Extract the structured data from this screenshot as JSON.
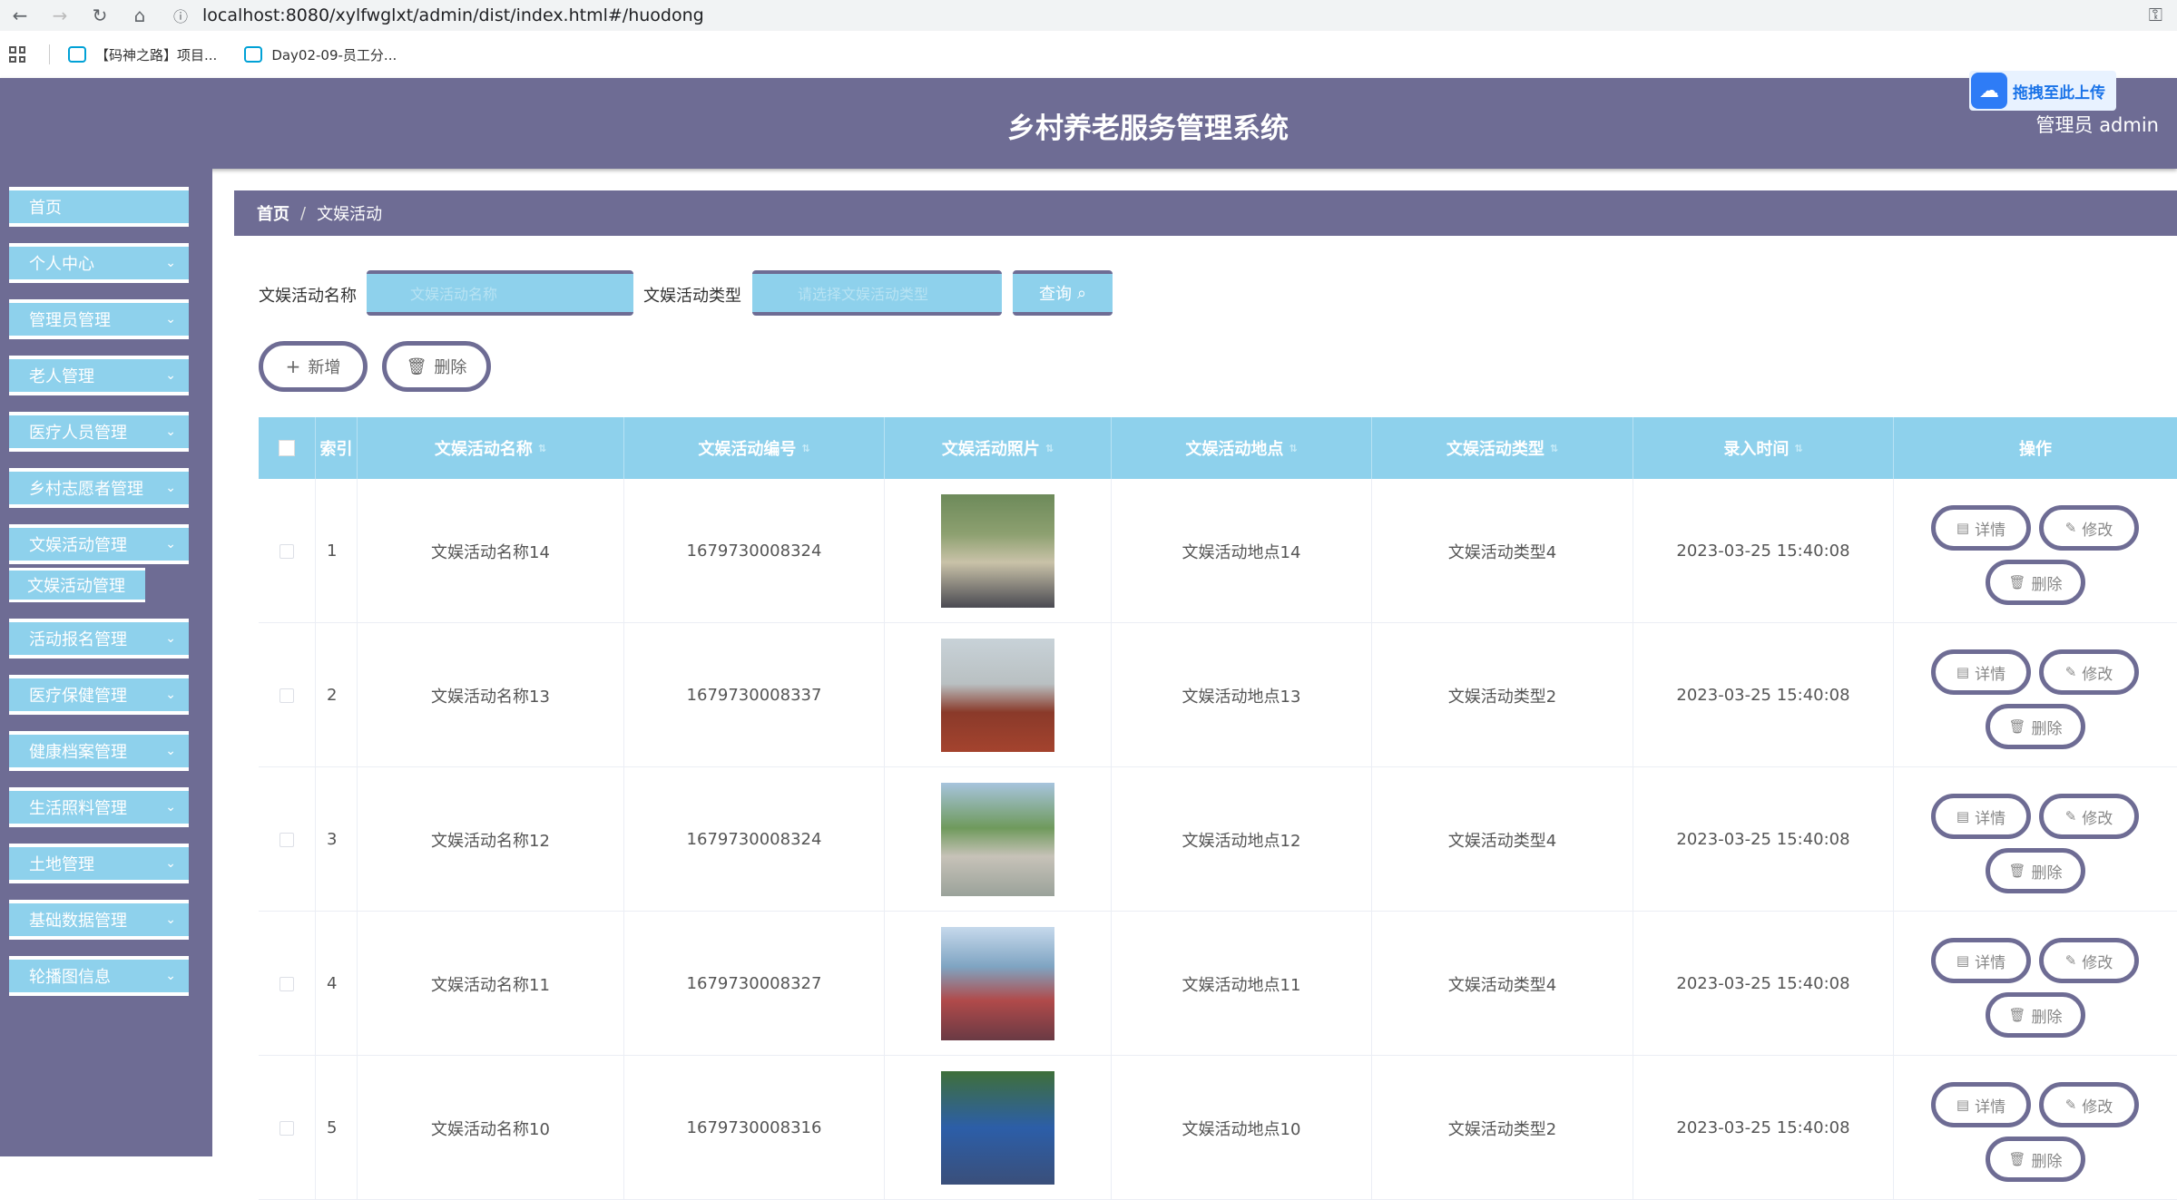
{
  "browser": {
    "url": "localhost:8080/xylfwglxt/admin/dist/index.html#/huodong",
    "bookmarks": [
      "【码神之路】项目...",
      "Day02-09-员工分..."
    ]
  },
  "header": {
    "title": "乡村养老服务管理系统",
    "upload_label": "拖拽至此上传",
    "user_label": "管理员 admin"
  },
  "sidebar": {
    "items": [
      {
        "label": "首页",
        "has_chevron": false
      },
      {
        "label": "个人中心",
        "has_chevron": true
      },
      {
        "label": "管理员管理",
        "has_chevron": true
      },
      {
        "label": "老人管理",
        "has_chevron": true
      },
      {
        "label": "医疗人员管理",
        "has_chevron": true
      },
      {
        "label": "乡村志愿者管理",
        "has_chevron": true
      },
      {
        "label": "文娱活动管理",
        "has_chevron": true
      },
      {
        "label": "活动报名管理",
        "has_chevron": true
      },
      {
        "label": "医疗保健管理",
        "has_chevron": true
      },
      {
        "label": "健康档案管理",
        "has_chevron": true
      },
      {
        "label": "生活照料管理",
        "has_chevron": true
      },
      {
        "label": "土地管理",
        "has_chevron": true
      },
      {
        "label": "基础数据管理",
        "has_chevron": true
      },
      {
        "label": "轮播图信息",
        "has_chevron": true
      }
    ],
    "active_sub": "文娱活动管理"
  },
  "breadcrumb": {
    "home": "首页",
    "sep": "/",
    "current": "文娱活动"
  },
  "search": {
    "name_label": "文娱活动名称",
    "name_placeholder": "文娱活动名称",
    "type_label": "文娱活动类型",
    "type_placeholder": "请选择文娱活动类型",
    "query_label": "查询"
  },
  "actions": {
    "add_label": "新增",
    "delete_label": "删除"
  },
  "table": {
    "columns": [
      "索引",
      "文娱活动名称",
      "文娱活动编号",
      "文娱活动照片",
      "文娱活动地点",
      "文娱活动类型",
      "录入时间",
      "操作"
    ],
    "rows": [
      {
        "index": "1",
        "name": "文娱活动名称14",
        "code": "1679730008324",
        "location": "文娱活动地点14",
        "type": "文娱活动类型4",
        "time": "2023-03-25 15:40:08"
      },
      {
        "index": "2",
        "name": "文娱活动名称13",
        "code": "1679730008337",
        "location": "文娱活动地点13",
        "type": "文娱活动类型2",
        "time": "2023-03-25 15:40:08"
      },
      {
        "index": "3",
        "name": "文娱活动名称12",
        "code": "1679730008324",
        "location": "文娱活动地点12",
        "type": "文娱活动类型4",
        "time": "2023-03-25 15:40:08"
      },
      {
        "index": "4",
        "name": "文娱活动名称11",
        "code": "1679730008327",
        "location": "文娱活动地点11",
        "type": "文娱活动类型4",
        "time": "2023-03-25 15:40:08"
      },
      {
        "index": "5",
        "name": "文娱活动名称10",
        "code": "1679730008316",
        "location": "文娱活动地点10",
        "type": "文娱活动类型2",
        "time": "2023-03-25 15:40:08"
      }
    ],
    "row_actions": {
      "detail": "详情",
      "edit": "修改",
      "delete": "删除"
    }
  },
  "colors": {
    "primary": "#6e6c94",
    "accent": "#8ed1ec"
  }
}
